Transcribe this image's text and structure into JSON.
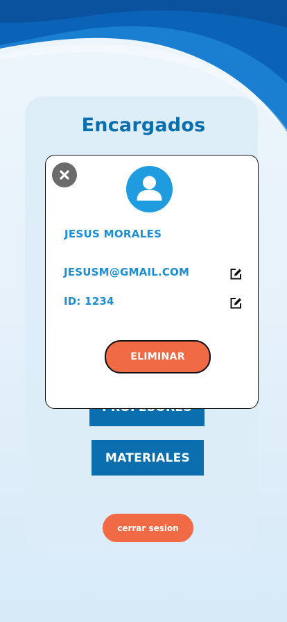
{
  "screen": {
    "title": "Encargados",
    "menu": {
      "profesores_label": "PROFESORES",
      "materiales_label": "MATERIALES"
    },
    "logout_label": "cerrar sesion"
  },
  "modal": {
    "name": "JESUS MORALES",
    "email": "JESUSM@GMAIL.COM",
    "id": "ID: 1234",
    "delete_label": "ELIMINAR"
  },
  "colors": {
    "primary": "#0a6eaf",
    "accent": "#ef6a45",
    "text_blue": "#1b8ed3",
    "avatar": "#1f9be0"
  },
  "icons": {
    "close": "close-circle-icon",
    "avatar": "user-icon",
    "edit": "edit-icon"
  }
}
